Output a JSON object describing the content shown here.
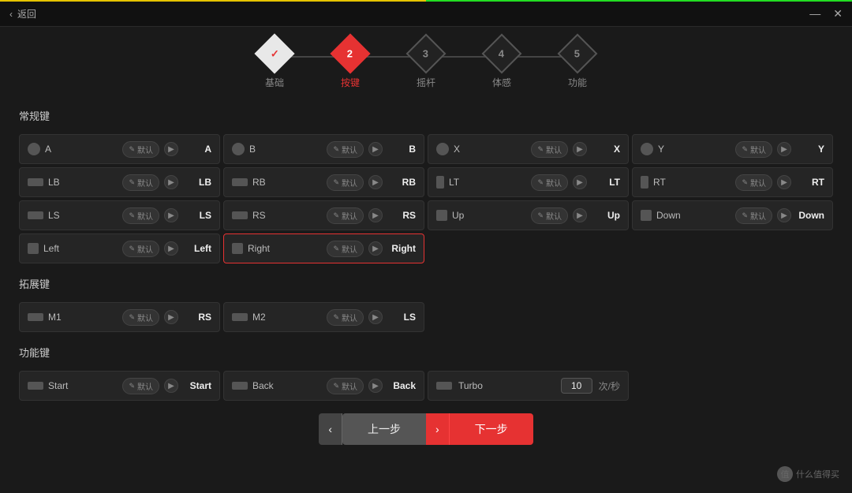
{
  "titlebar": {
    "back_label": "返回",
    "minimize_label": "—",
    "close_label": "✕"
  },
  "steps": [
    {
      "id": 1,
      "label": "基础",
      "state": "completed",
      "display": "✓"
    },
    {
      "id": 2,
      "label": "按键",
      "state": "active",
      "display": "2"
    },
    {
      "id": 3,
      "label": "摇杆",
      "state": "inactive",
      "display": "3"
    },
    {
      "id": 4,
      "label": "体感",
      "state": "inactive",
      "display": "4"
    },
    {
      "id": 5,
      "label": "功能",
      "state": "inactive",
      "display": "5"
    }
  ],
  "sections": {
    "regular_keys": {
      "title": "常规键",
      "keys": [
        {
          "icon": "circle",
          "name": "A",
          "default": "默认",
          "value": "A"
        },
        {
          "icon": "circle",
          "name": "B",
          "default": "默认",
          "value": "B"
        },
        {
          "icon": "circle",
          "name": "X",
          "default": "默认",
          "value": "X"
        },
        {
          "icon": "circle",
          "name": "Y",
          "default": "默认",
          "value": "Y"
        },
        {
          "icon": "rect-h",
          "name": "LB",
          "default": "默认",
          "value": "LB"
        },
        {
          "icon": "rect-h",
          "name": "RB",
          "default": "默认",
          "value": "RB"
        },
        {
          "icon": "rect-v",
          "name": "LT",
          "default": "默认",
          "value": "LT"
        },
        {
          "icon": "rect-v",
          "name": "RT",
          "default": "默认",
          "value": "RT"
        },
        {
          "icon": "rect-h",
          "name": "LS",
          "default": "默认",
          "value": "LS"
        },
        {
          "icon": "rect-h",
          "name": "RS",
          "default": "默认",
          "value": "RS"
        },
        {
          "icon": "square",
          "name": "Up",
          "default": "默认",
          "value": "Up"
        },
        {
          "icon": "square",
          "name": "Down",
          "default": "默认",
          "value": "Down"
        },
        {
          "icon": "square",
          "name": "Left",
          "default": "默认",
          "value": "Left"
        },
        {
          "icon": "square",
          "name": "Right",
          "default": "默认",
          "value": "Right"
        }
      ]
    },
    "extended_keys": {
      "title": "拓展键",
      "keys": [
        {
          "icon": "rect-h",
          "name": "M1",
          "default": "默认",
          "value": "RS"
        },
        {
          "icon": "rect-h",
          "name": "M2",
          "default": "默认",
          "value": "LS"
        }
      ]
    },
    "function_keys": {
      "title": "功能键",
      "keys": [
        {
          "icon": "rect-h",
          "name": "Start",
          "default": "默认",
          "value": "Start"
        },
        {
          "icon": "rect-h",
          "name": "Back",
          "default": "默认",
          "value": "Back"
        }
      ],
      "turbo": {
        "name": "Turbo",
        "value": "10",
        "unit": "次/秒"
      }
    }
  },
  "buttons": {
    "prev_label": "上一步",
    "next_label": "下一步"
  },
  "watermark": "什么值得买"
}
